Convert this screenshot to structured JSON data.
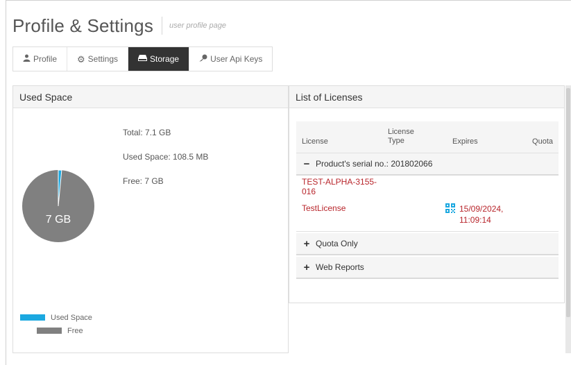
{
  "header": {
    "title": "Profile & Settings",
    "subtitle": "user profile page"
  },
  "tabs": [
    {
      "label": "Profile",
      "icon": "user-icon",
      "active": false
    },
    {
      "label": "Settings",
      "icon": "gear-icon",
      "active": false
    },
    {
      "label": "Storage",
      "icon": "hard-drive-icon",
      "active": true
    },
    {
      "label": "User Api Keys",
      "icon": "key-icon",
      "active": false
    }
  ],
  "used_space": {
    "heading": "Used Space",
    "total": "Total: 7.1 GB",
    "used": "Used Space: 108.5 MB",
    "free": "Free: 7 GB",
    "pie_label": "7 GB",
    "legend": [
      {
        "label": "Used Space",
        "color": "#1ba8e0"
      },
      {
        "label": "Free",
        "color": "#808080"
      }
    ],
    "chart": {
      "used_fraction": 0.015,
      "used_color": "#1ba8e0",
      "free_color": "#808080"
    }
  },
  "licenses": {
    "heading": "List of Licenses",
    "columns": {
      "license": "License",
      "type_line1": "License",
      "type_line2": "Type",
      "expires": "Expires",
      "quota": "Quota"
    },
    "groups": [
      {
        "sign": "−",
        "label": "Product's serial no.: 201802066"
      },
      {
        "sign": "+",
        "label": "Quota Only"
      },
      {
        "sign": "+",
        "label": "Web Reports"
      }
    ],
    "rows": [
      {
        "license": "TEST-ALPHA-3155-016",
        "expires_line1": "",
        "expires_line2": ""
      },
      {
        "license": "TestLicense",
        "expires_line1": "15/09/2024,",
        "expires_line2": "11:09:14"
      }
    ],
    "accent_color": "#b8252b",
    "qr_color": "#1ba8e0"
  }
}
